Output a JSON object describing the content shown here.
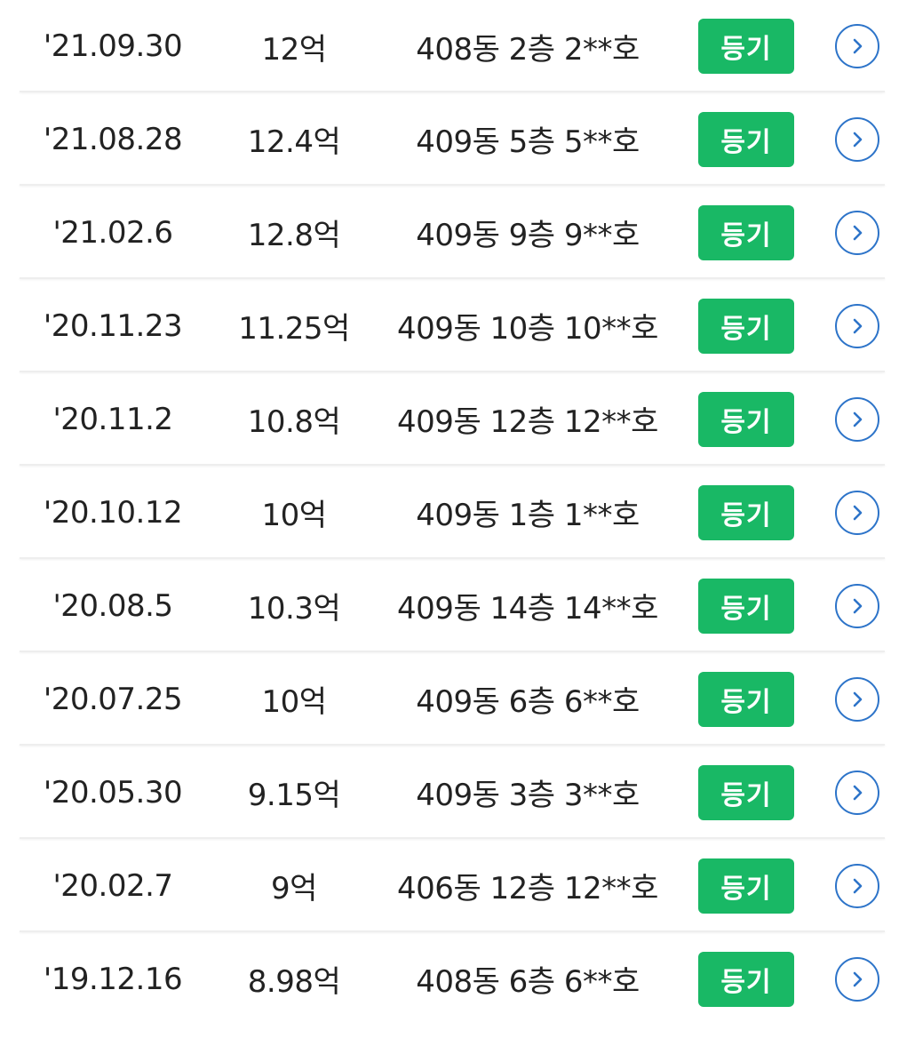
{
  "transactions": [
    {
      "date": "'21.09.30",
      "price": "12억",
      "unit": "408동 2층 2**호",
      "button": "등기",
      "detail_icon": "chevron-right-icon"
    },
    {
      "date": "'21.08.28",
      "price": "12.4억",
      "unit": "409동 5층 5**호",
      "button": "등기",
      "detail_icon": "chevron-right-icon"
    },
    {
      "date": "'21.02.6",
      "price": "12.8억",
      "unit": "409동 9층 9**호",
      "button": "등기",
      "detail_icon": "chevron-right-icon"
    },
    {
      "date": "'20.11.23",
      "price": "11.25억",
      "unit": "409동 10층 10**호",
      "button": "등기",
      "detail_icon": "chevron-right-icon"
    },
    {
      "date": "'20.11.2",
      "price": "10.8억",
      "unit": "409동 12층 12**호",
      "button": "등기",
      "detail_icon": "chevron-right-icon"
    },
    {
      "date": "'20.10.12",
      "price": "10억",
      "unit": "409동 1층 1**호",
      "button": "등기",
      "detail_icon": "chevron-right-icon"
    },
    {
      "date": "'20.08.5",
      "price": "10.3억",
      "unit": "409동 14층 14**호",
      "button": "등기",
      "detail_icon": "chevron-right-icon"
    },
    {
      "date": "'20.07.25",
      "price": "10억",
      "unit": "409동 6층 6**호",
      "button": "등기",
      "detail_icon": "chevron-right-icon"
    },
    {
      "date": "'20.05.30",
      "price": "9.15억",
      "unit": "409동 3층 3**호",
      "button": "등기",
      "detail_icon": "chevron-right-icon"
    },
    {
      "date": "'20.02.7",
      "price": "9억",
      "unit": "406동 12층 12**호",
      "button": "등기",
      "detail_icon": "chevron-right-icon"
    },
    {
      "date": "'19.12.16",
      "price": "8.98억",
      "unit": "408동 6층 6**호",
      "button": "등기",
      "detail_icon": "chevron-right-icon"
    }
  ],
  "colors": {
    "button_bg": "#19b865",
    "button_text": "#ffffff",
    "detail_icon": "#2d74c9",
    "text": "#222222"
  }
}
